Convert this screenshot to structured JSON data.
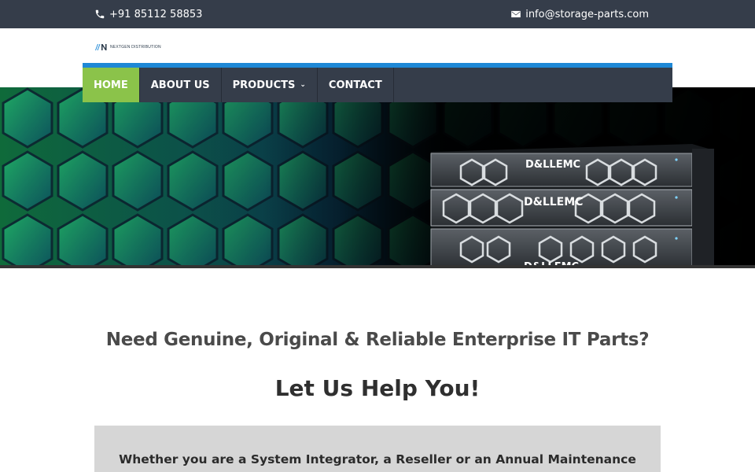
{
  "topbar": {
    "phone": "+91 85112 58853",
    "email": "info@storage-parts.com",
    "phone_icon": "phone-icon",
    "email_icon": "envelope-icon"
  },
  "logo": {
    "text": "NEXTGEN DISTRIBUTION"
  },
  "nav": {
    "items": [
      {
        "label": "HOME",
        "active": true
      },
      {
        "label": "ABOUT US"
      },
      {
        "label": "PRODUCTS"
      },
      {
        "label": "CONTACT"
      }
    ],
    "active_color": "#8bc34a",
    "accent_color": "#1e88d6"
  },
  "hero": {
    "brand_lines": [
      "D&LLEMC",
      "D&LLEMC",
      "D&LLEMC"
    ]
  },
  "main": {
    "headline": "Need Genuine, Original & Reliable Enterprise IT Parts?",
    "subheadline": "Let Us Help You!",
    "intro": "Whether you are a System Integrator, a Reseller or an Annual Maintenance"
  }
}
